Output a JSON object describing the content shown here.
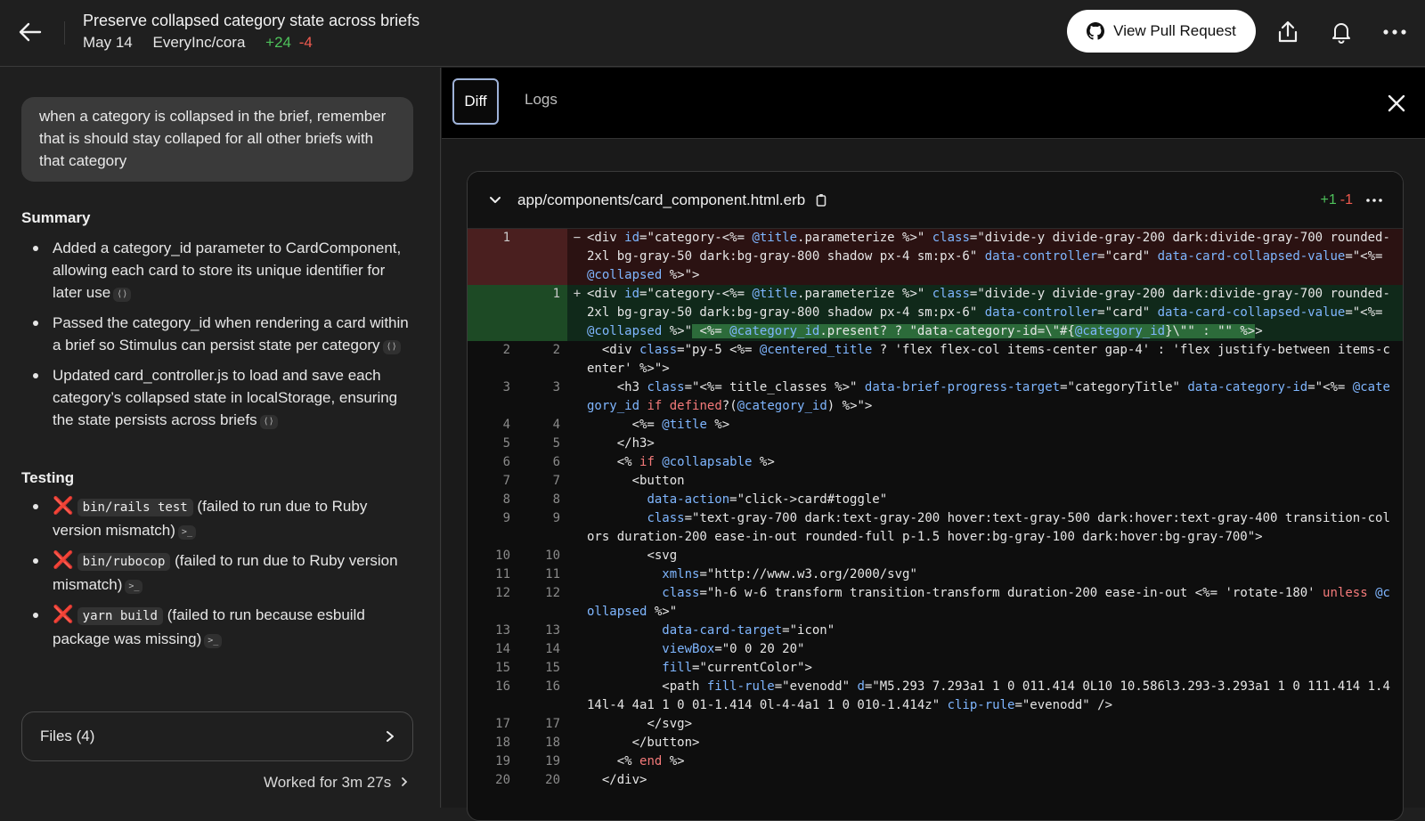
{
  "header": {
    "title": "Preserve collapsed category state across briefs",
    "date": "May 14",
    "repo": "EveryInc/cora",
    "additions": "+24",
    "deletions": "-4",
    "pr_button": "View Pull Request"
  },
  "left": {
    "prompt": "when a category is collapsed in the brief, remember that is should stay collaped for all other briefs with that category",
    "summary_heading": "Summary",
    "summary": [
      "Added a category_id parameter to CardComponent, allowing each card to store its unique identifier for later use",
      "Passed the category_id when rendering a card within a brief so Stimulus can persist state per category",
      "Updated card_controller.js to load and save each category’s collapsed state in localStorage, ensuring the state persists across briefs"
    ],
    "summary_citation": "⟨⟩",
    "testing_heading": "Testing",
    "testing": [
      {
        "status": "❌",
        "command": "bin/rails test",
        "note": "(failed to run due to Ruby version mismatch)"
      },
      {
        "status": "❌",
        "command": "bin/rubocop",
        "note": "(failed to run due to Ruby version mismatch)"
      },
      {
        "status": "❌",
        "command": "yarn build",
        "note": "(failed to run because esbuild package was missing)"
      }
    ],
    "terminal_citation": ">_",
    "files_label": "Files (4)",
    "worked_label": "Worked for 3m 27s"
  },
  "right": {
    "tabs": [
      "Diff",
      "Logs"
    ],
    "file_path": "app/components/card_component.html.erb",
    "file_additions": "+1",
    "file_deletions": "-1"
  },
  "diff_lines": [
    {
      "type": "del",
      "old": "1",
      "new": "",
      "sign": "−",
      "html": "<span class=\"t-tag\">&lt;div</span> <span class=\"t-attr\">id</span>=\"category-&lt;%= <span class=\"t-var\">@title</span>.parameterize %&gt;\" <span class=\"t-attr\">class</span>=\"divide-y divide-gray-200 dark:divide-gray-700 rounded-2xl bg-gray-50 dark:bg-gray-800 shadow px-4 sm:px-6\" <span class=\"t-attr\">data-controller</span>=\"card\" <span class=\"t-attr\">data-card-collapsed-value</span>=\"&lt;%= <span class=\"t-var\">@collapsed</span> %&gt;\"&gt;"
    },
    {
      "type": "add",
      "old": "",
      "new": "1",
      "sign": "+",
      "html": "<span class=\"t-tag\">&lt;div</span> <span class=\"t-attr\">id</span>=\"category-&lt;%= <span class=\"t-var\">@title</span>.parameterize %&gt;\" <span class=\"t-attr\">class</span>=\"divide-y divide-gray-200 dark:divide-gray-700 rounded-2xl bg-gray-50 dark:bg-gray-800 shadow px-4 sm:px-6\" <span class=\"t-attr\">data-controller</span>=\"card\" <span class=\"t-attr\">data-card-collapsed-value</span>=\"&lt;%= <span class=\"t-var\">@collapsed</span> %&gt;\"<span class=\"hl\"> &lt;%= <span class=\"t-var\">@category_id</span>.present? ? \"data-category-id=\\\"#{<span class=\"t-var\">@category_id</span>}\\\"\" : \"\" %&gt;</span>&gt;"
    },
    {
      "type": "ctx",
      "old": "2",
      "new": "2",
      "sign": "",
      "html": "  <span class=\"t-tag\">&lt;div</span> <span class=\"t-attr\">class</span>=\"py-5 &lt;%= <span class=\"t-var\">@centered_title</span> ? 'flex flex-col items-center gap-4' : 'flex justify-between items-center' %&gt;\"&gt;"
    },
    {
      "type": "ctx",
      "old": "3",
      "new": "3",
      "sign": "",
      "html": "    <span class=\"t-tag\">&lt;h3</span> <span class=\"t-attr\">class</span>=\"&lt;%= title_classes %&gt;\" <span class=\"t-attr\">data-brief-progress-target</span>=\"categoryTitle\" <span class=\"t-attr\">data-category-id</span>=\"&lt;%= <span class=\"t-var\">@category_id</span> <span class=\"t-kw\">if</span> <span class=\"t-kw\">defined</span>?(<span class=\"t-var\">@category_id</span>) %&gt;\"&gt;"
    },
    {
      "type": "ctx",
      "old": "4",
      "new": "4",
      "sign": "",
      "html": "      &lt;%= <span class=\"t-var\">@title</span> %&gt;"
    },
    {
      "type": "ctx",
      "old": "5",
      "new": "5",
      "sign": "",
      "html": "    &lt;/h3&gt;"
    },
    {
      "type": "ctx",
      "old": "6",
      "new": "6",
      "sign": "",
      "html": "    &lt;% <span class=\"t-kw\">if</span> <span class=\"t-var\">@collapsable</span> %&gt;"
    },
    {
      "type": "ctx",
      "old": "7",
      "new": "7",
      "sign": "",
      "html": "      &lt;button"
    },
    {
      "type": "ctx",
      "old": "8",
      "new": "8",
      "sign": "",
      "html": "        <span class=\"t-attr\">data-action</span>=\"click-&gt;card#toggle\""
    },
    {
      "type": "ctx",
      "old": "9",
      "new": "9",
      "sign": "",
      "html": "        <span class=\"t-attr\">class</span>=\"text-gray-700 dark:text-gray-200 hover:text-gray-500 dark:hover:text-gray-400 transition-colors duration-200 ease-in-out rounded-full p-1.5 hover:bg-gray-100 dark:hover:bg-gray-700\"&gt;"
    },
    {
      "type": "ctx",
      "old": "10",
      "new": "10",
      "sign": "",
      "html": "        &lt;svg"
    },
    {
      "type": "ctx",
      "old": "11",
      "new": "11",
      "sign": "",
      "html": "          <span class=\"t-attr\">xmlns</span>=\"http://www.w3.org/2000/svg\""
    },
    {
      "type": "ctx",
      "old": "12",
      "new": "12",
      "sign": "",
      "html": "          <span class=\"t-attr\">class</span>=\"h-6 w-6 transform transition-transform duration-200 ease-in-out &lt;%= 'rotate-180' <span class=\"t-kw\">unless</span> <span class=\"t-var\">@collapsed</span> %&gt;\""
    },
    {
      "type": "ctx",
      "old": "13",
      "new": "13",
      "sign": "",
      "html": "          <span class=\"t-attr\">data-card-target</span>=\"icon\""
    },
    {
      "type": "ctx",
      "old": "14",
      "new": "14",
      "sign": "",
      "html": "          <span class=\"t-attr\">viewBox</span>=\"0 0 20 20\""
    },
    {
      "type": "ctx",
      "old": "15",
      "new": "15",
      "sign": "",
      "html": "          <span class=\"t-attr\">fill</span>=\"currentColor\"&gt;"
    },
    {
      "type": "ctx",
      "old": "16",
      "new": "16",
      "sign": "",
      "html": "          &lt;path <span class=\"t-attr\">fill-rule</span>=\"evenodd\" <span class=\"t-attr\">d</span>=\"M5.293 7.293a1 1 0 011.414 0L10 10.586l3.293-3.293a1 1 0 111.414 1.414l-4 4a1 1 0 01-1.414 0l-4-4a1 1 0 010-1.414z\" <span class=\"t-attr\">clip-rule</span>=\"evenodd\" /&gt;"
    },
    {
      "type": "ctx",
      "old": "17",
      "new": "17",
      "sign": "",
      "html": "        &lt;/svg&gt;"
    },
    {
      "type": "ctx",
      "old": "18",
      "new": "18",
      "sign": "",
      "html": "      &lt;/button&gt;"
    },
    {
      "type": "ctx",
      "old": "19",
      "new": "19",
      "sign": "",
      "html": "    &lt;% <span class=\"t-kw\">end</span> %&gt;"
    },
    {
      "type": "ctx",
      "old": "20",
      "new": "20",
      "sign": "",
      "html": "  &lt;/div&gt;"
    }
  ]
}
